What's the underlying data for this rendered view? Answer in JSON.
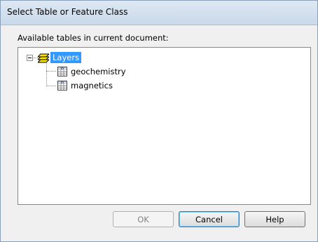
{
  "window": {
    "title": "Select Table or Feature Class"
  },
  "caption": "Available tables in current document:",
  "tree": {
    "root": {
      "label": "Layers",
      "icon": "layers-icon",
      "expanded": true,
      "selected": true
    },
    "children": [
      {
        "label": "geochemistry",
        "icon": "xy-table-icon"
      },
      {
        "label": "magnetics",
        "icon": "xy-table-icon"
      }
    ]
  },
  "buttons": {
    "ok": "OK",
    "cancel": "Cancel",
    "help": "Help"
  },
  "colors": {
    "selection": "#3399ff",
    "titlebar": "#c9d9ea"
  }
}
